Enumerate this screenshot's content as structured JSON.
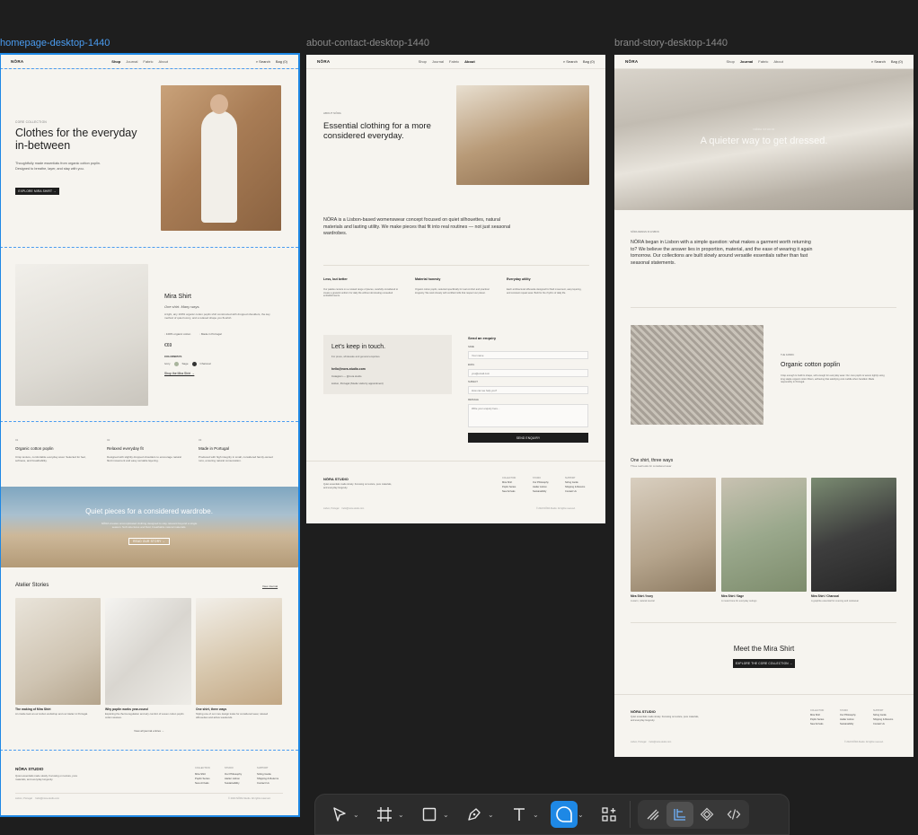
{
  "frames": {
    "homepage": {
      "label": "homepage-desktop-1440"
    },
    "about": {
      "label": "about-contact-desktop-1440"
    },
    "brand": {
      "label": "brand-story-desktop-1440"
    }
  },
  "nav": {
    "logo": "NŌRA",
    "shop": "Shop",
    "journal": "Journal",
    "fabric": "Fabric",
    "about": "About",
    "search": "Search",
    "bag": "Bag (0)"
  },
  "home": {
    "hero_eyebrow": "CORE COLLECTION",
    "hero_title": "Clothes for the everyday in-between",
    "hero_body": "Thoughtfully made essentials from organic cotton poplin. Designed to breathe, layer, and stay with you.",
    "hero_cta": "EXPLORE MIRA SHIRT →",
    "product_title": "Mira Shirt",
    "product_sub": "One shirt. Many ways.",
    "product_desc": "A light, airy 100% organic cotton poplin shirt constructed with dropped shoulders, the key method of quiet luxury, and a relaxed shape you flourish.",
    "product_f1": "100% organic cotton",
    "product_f2": "Made in Portugal",
    "product_price": "€69",
    "colorways": "COLORWAYS",
    "c1": "Ivory",
    "c2": "Sage",
    "c3": "Charcoal",
    "product_link": "Shop the Mira Shirt →",
    "f1_num": "01",
    "f1_title": "Organic cotton poplin",
    "f1_body": "Crisp texture, comfortable everyday wear. Selected for feel, softness, and breathability.",
    "f2_num": "02",
    "f2_title": "Relaxed everyday fit",
    "f2_body": "Designed with slightly dropped shoulders to encourage natural fluid movement and easy versatile layering.",
    "f3_num": "03",
    "f3_title": "Made in Portugal",
    "f3_body": "Produced with high integrity in small, considered family-owned runs, ensuring natural conservation.",
    "banner_title": "Quiet pieces for a considered wardrobe.",
    "banner_body": "NŌRA creates uncomplicated clothing designed to stay relevant beyond a single season. Soft structures and fluid, breathable natural materials.",
    "banner_cta": "READ OUR STORY →",
    "stories_title": "Atelier Stories",
    "stories_link": "View Journal",
    "st1_title": "The making of Mira Shirt",
    "st1_body": "An inside look at our Lisbon workshop and our Atelier in Portugal.",
    "st2_title": "Why poplin works year-round",
    "st2_body": "Exploring the thermoregulation and airy comfort of woven cotton poplin cotton weaves.",
    "st3_title": "One shirt, three ways",
    "st3_body": "Styling one of our core design looks for considered wear, relaxed silhouettes and active weekends.",
    "stories_more": "View all journal entries →"
  },
  "footer": {
    "brand": "NŌRA STUDIO",
    "desc": "Quiet essentials made slowly. Focusing on texture, pure materials, and everyday longevity.",
    "col1": "COLLECTION",
    "col1a": "Mira Shirt",
    "col1b": "Poplin Series",
    "col1c": "New Arrivals",
    "col2": "STUDIO",
    "col2a": "Our Philosophy",
    "col2b": "Atelier Lisbon",
    "col2c": "Sustainability",
    "col3": "SUPPORT",
    "col3a": "Sizing Guide",
    "col3b": "Shipping & Returns",
    "col3c": "Contact Us",
    "bottom_left": "Lisbon, Portugal     hello@nora-studio.com",
    "bottom_right": "© 2024 NŌRA Studio. All rights reserved."
  },
  "about": {
    "eyebrow": "ABOUT NŌRA",
    "title": "Essential clothing for a more considered everyday.",
    "intro": "NŌRA is a Lisbon-based womenswear concept focused on quiet silhouettes, natural materials and lasting utility. We make pieces that fit into real routines — not just seasonal wardrobes.",
    "v1_title": "Less, but better",
    "v1_body": "Our palette centers on a curated range of pieces, carefully considered to create a graceful uniform for daily life without dominating unneeded embellishments.",
    "v2_title": "Material honesty",
    "v2_body": "Organic cotton poplin, selected specifically for real comfort and practical longevity. We work closely with certified mills that respect our planet.",
    "v3_title": "Everyday utility",
    "v3_body": "Each architectural silhouette designed for fluid movement, easy layering, and constant repeat wear. Built for the rhythm of daily life.",
    "contact_title": "Let's keep in touch.",
    "contact_body": "For press, wholesale and general enquiries.",
    "contact_email": "hello@nora-studio.com",
    "contact_ig": "Instagram — @nora.studio",
    "contact_addr": "Lisbon, Portugal (Studio visits by appointment)",
    "form_title": "Send an enquiry",
    "f_name": "NAME",
    "f_name_ph": "Your name",
    "f_email": "EMAIL",
    "f_email_ph": "you@email.com",
    "f_subject": "SUBJECT",
    "f_subject_ph": "How can we help you?",
    "f_message": "MESSAGE",
    "f_message_ph": "Write your enquiry here...",
    "f_submit": "SEND ENQUIRY"
  },
  "brand": {
    "hero_eyebrow": "NŌRA STUDIO",
    "hero_title": "A quieter way to get dressed.",
    "eyebrow": "NŌRA DESIGN IN LISBON",
    "body": "NŌRA began in Lisbon with a simple question: what makes a garment worth returning to? We believe the answer lies in proportion, material, and the ease of wearing it again tomorrow. Our collections are built slowly around versatile essentials rather than fast seasonal statements.",
    "fabric_eyebrow": "THE FABRIC",
    "fabric_title": "Organic cotton poplin",
    "fabric_body": "Crisp enough to hold its shape, soft enough for everyday wear. Our core poplin is woven tightly using long staple organic cotton fibers, achieving that satisfying cool cuddle when handled. Made responsibly in Portugal.",
    "ways_title": "One shirt, three ways",
    "ways_sub": "Three real looks for considered wear",
    "w1_title": "Mira Shirt / Ivory",
    "w1_body": "A warm, natural neutral",
    "w2_title": "Mira Shirt / Sage",
    "w2_body": "A muted tone for everyday outings",
    "w3_title": "Mira Shirt / Charcoal",
    "w3_body": "A graphite essential for evening and workwear",
    "meet_title": "Meet the Mira Shirt",
    "meet_cta": "EXPLORE THE CORE COLLECTION →"
  },
  "toolbar": {
    "tools": [
      "move-tool",
      "frame-tool",
      "shape-tool",
      "pen-tool",
      "text-tool",
      "comment-tool",
      "actions-tool"
    ],
    "active": "comment-tool",
    "modes": [
      "draw-mode",
      "design-mode",
      "prototype-mode",
      "dev-mode"
    ],
    "active_mode": "design-mode"
  },
  "colors": {
    "selection": "#1e88e5",
    "accent_dark": "#1d1d1d",
    "page_bg": "#f6f4ef",
    "canvas_bg": "#1e1e1e"
  }
}
